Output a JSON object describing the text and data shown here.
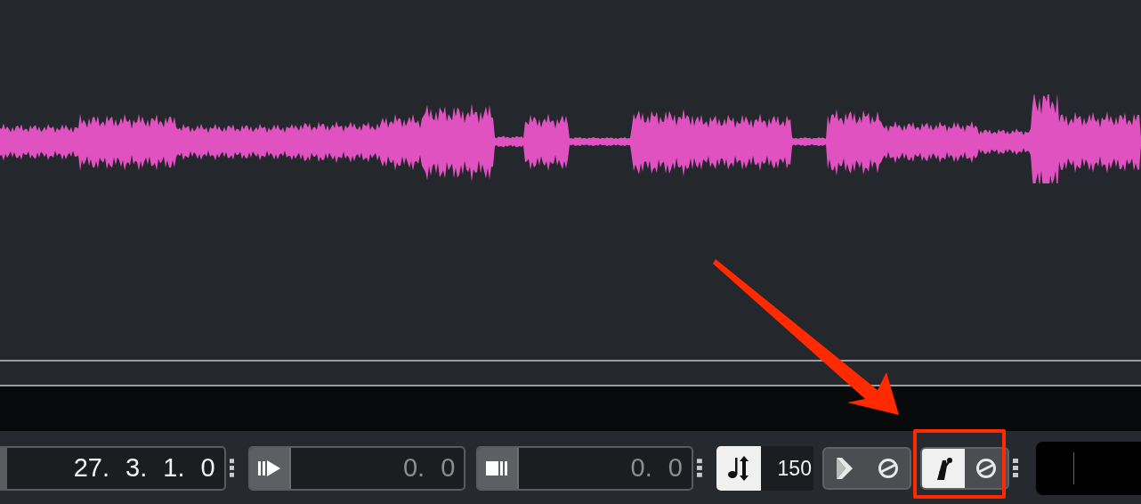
{
  "position": {
    "segments": [
      "27.",
      "3.",
      "1.",
      "0"
    ]
  },
  "left_locator": {
    "segments": [
      "0.",
      "0"
    ]
  },
  "right_locator": {
    "segments": [
      "0.",
      "0"
    ]
  },
  "tempo": {
    "value": "150",
    "selected": true
  },
  "toggle_groups": [
    {
      "items": [
        {
          "kind": "preroll",
          "selected": false
        },
        {
          "kind": "precount",
          "selected": false
        }
      ]
    },
    {
      "items": [
        {
          "kind": "metronome",
          "selected": true
        },
        {
          "kind": "precount",
          "selected": false
        }
      ]
    }
  ],
  "annotation": {
    "arrow": true,
    "highlight_box": true
  }
}
